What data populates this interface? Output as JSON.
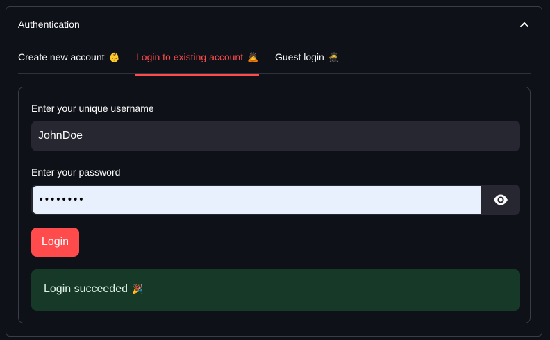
{
  "expander": {
    "title": "Authentication"
  },
  "tabs": [
    {
      "label": "Create new account",
      "emoji": "👶",
      "active": false
    },
    {
      "label": "Login to existing account",
      "emoji": "🙇",
      "active": true
    },
    {
      "label": "Guest login",
      "emoji": "🥷",
      "active": false
    }
  ],
  "form": {
    "username_label": "Enter your unique username",
    "username_value": "JohnDoe",
    "password_label": "Enter your password",
    "password_value": "JohnDoe1",
    "login_label": "Login"
  },
  "alert": {
    "message": "Login succeeded",
    "emoji": "🎉"
  },
  "colors": {
    "background": "#0e1117",
    "accent": "#ff4b4b",
    "input_bg": "#262730",
    "autofill_bg": "#e8f0fe",
    "success_bg": "#173928",
    "text": "#fafafa"
  },
  "icons": {
    "collapse": "chevron-up-icon",
    "toggle_password": "eye-icon"
  }
}
